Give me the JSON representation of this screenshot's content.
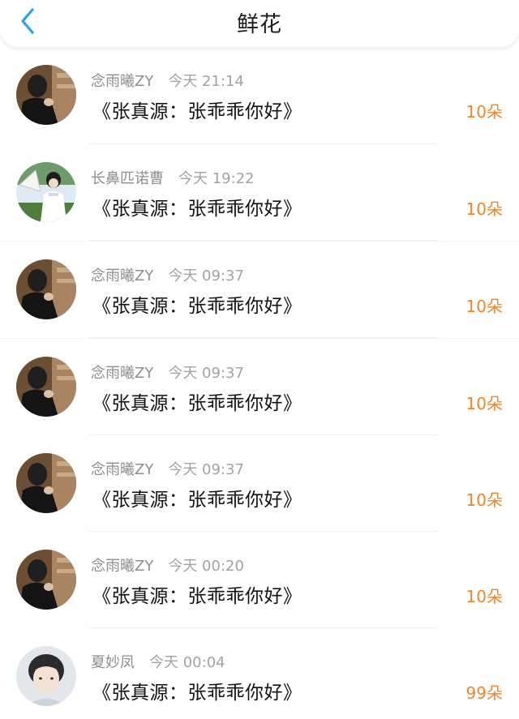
{
  "header": {
    "title": "鲜花",
    "back_icon": "chevron-left-icon"
  },
  "colors": {
    "accent_blue": "#2aa1f0",
    "amount_orange": "#f2852b",
    "meta_gray": "#8e8e8e"
  },
  "gifts": [
    {
      "name": "念雨曦ZY",
      "time": "今天 21:14",
      "song": "《张真源：张乖乖你好》",
      "amount": "10朵",
      "avatar": "dark-portrait-avatar"
    },
    {
      "name": "长鼻匹诺曹",
      "time": "今天 19:22",
      "song": "《张真源：张乖乖你好》",
      "amount": "10朵",
      "avatar": "fan-boy-avatar"
    },
    {
      "name": "念雨曦ZY",
      "time": "今天 09:37",
      "song": "《张真源：张乖乖你好》",
      "amount": "10朵",
      "avatar": "dark-portrait-avatar"
    },
    {
      "name": "念雨曦ZY",
      "time": "今天 09:37",
      "song": "《张真源：张乖乖你好》",
      "amount": "10朵",
      "avatar": "dark-portrait-avatar"
    },
    {
      "name": "念雨曦ZY",
      "time": "今天 09:37",
      "song": "《张真源：张乖乖你好》",
      "amount": "10朵",
      "avatar": "dark-portrait-avatar"
    },
    {
      "name": "念雨曦ZY",
      "time": "今天 00:20",
      "song": "《张真源：张乖乖你好》",
      "amount": "10朵",
      "avatar": "dark-portrait-avatar"
    },
    {
      "name": "夏妙凤",
      "time": "今天 00:04",
      "song": "《张真源：张乖乖你好》",
      "amount": "99朵",
      "avatar": "boy-portrait-avatar"
    }
  ]
}
